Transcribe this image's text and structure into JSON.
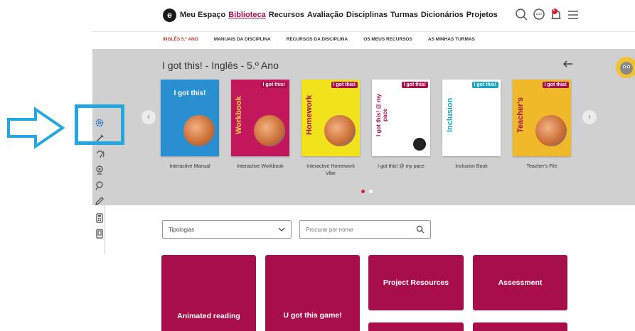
{
  "header": {
    "logo_letter": "e",
    "nav": [
      "Meu Espaço",
      "Biblioteca",
      "Recursos",
      "Avaliação",
      "Disciplinas",
      "Turmas",
      "Dicionários",
      "Projetos"
    ],
    "active_nav": "Biblioteca",
    "notification_count": "1"
  },
  "subnav": {
    "items": [
      "INGLÊS 5.º ANO",
      "MANUAIS DA DISCIPLINA",
      "RECURSOS DA DISCIPLINA",
      "OS MEUS RECURSOS",
      "AS MINHAS TURMAS"
    ]
  },
  "carousel": {
    "title": "I got this! - Inglês - 5.º Ano",
    "books": [
      {
        "label": "Interactive Manual",
        "cover_color": "#2a8fd0",
        "cover_text": "I got this!"
      },
      {
        "label": "Interactive Workbook",
        "cover_color": "#c2185b",
        "cover_text": "Workbook"
      },
      {
        "label": "Interactive Homework Vibe",
        "cover_color": "#f2e21c",
        "cover_text": "Homework"
      },
      {
        "label": "I got this! @ my pace",
        "cover_color": "#ffffff",
        "cover_text": "I got this! @ my pace"
      },
      {
        "label": "Inclusion Book",
        "cover_color": "#ffffff",
        "cover_text": "Inclusion"
      },
      {
        "label": "Teacher's File",
        "cover_color": "#f0b92a",
        "cover_text": "Teacher's"
      }
    ],
    "cover_badge": "I got this!",
    "page_dots": 2,
    "active_dot": 1
  },
  "filters": {
    "typology_value": "Tipologias",
    "search_placeholder": "Procurar por nome"
  },
  "tiles": [
    "Animated reading",
    "U got this game!",
    "Project Resources",
    "Assessment"
  ],
  "colors": {
    "accent": "#a80f4a",
    "highlight": "#22a7e0",
    "panel_bg": "#d0d0d0"
  },
  "icons": {
    "toolbar": [
      "settings-icon",
      "magic-icon",
      "ear-icon",
      "webcam-icon",
      "pin-icon",
      "pencil-icon",
      "calculator-icon",
      "tablet-icon"
    ],
    "top_right": [
      "search-icon",
      "chat-icon",
      "bell-icon",
      "menu-icon"
    ]
  }
}
